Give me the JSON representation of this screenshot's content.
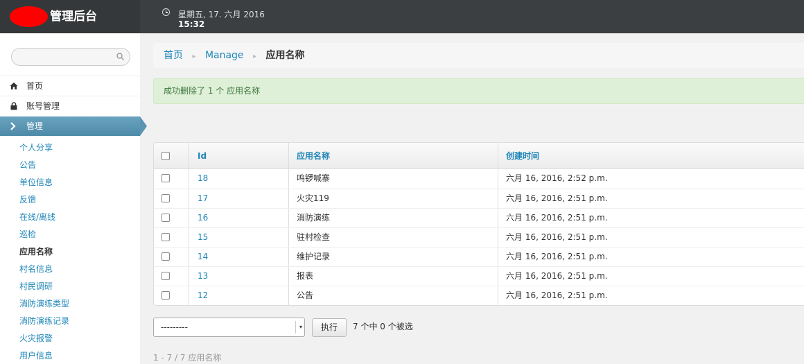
{
  "header": {
    "brand_title": "管理后台",
    "date": "星期五, 17. 六月 2016",
    "time": "15:32"
  },
  "sidebar": {
    "search_placeholder": "",
    "items": [
      {
        "label": "首页",
        "icon": "home-icon"
      },
      {
        "label": "账号管理",
        "icon": "lock-icon"
      }
    ],
    "active_item": {
      "label": "管理",
      "icon": "chevron-right-icon"
    },
    "subitems": [
      {
        "label": "个人分享"
      },
      {
        "label": "公告"
      },
      {
        "label": "单位信息"
      },
      {
        "label": "反馈"
      },
      {
        "label": "在线/离线"
      },
      {
        "label": "巡检"
      },
      {
        "label": "应用名称",
        "current": true
      },
      {
        "label": "村名信息"
      },
      {
        "label": "村民调研"
      },
      {
        "label": "消防演练类型"
      },
      {
        "label": "消防演练记录"
      },
      {
        "label": "火灾报警"
      },
      {
        "label": "用户信息"
      }
    ]
  },
  "breadcrumb": {
    "home": "首页",
    "section": "Manage",
    "current": "应用名称",
    "separator": "▸"
  },
  "alert": {
    "message": "成功删除了 1 个 应用名称"
  },
  "table": {
    "columns": [
      "Id",
      "应用名称",
      "创建时间"
    ],
    "rows": [
      {
        "id": "18",
        "name": "鸣锣喊寨",
        "created": "六月 16, 2016, 2:52 p.m."
      },
      {
        "id": "17",
        "name": "火灾119",
        "created": "六月 16, 2016, 2:51 p.m."
      },
      {
        "id": "16",
        "name": "消防演练",
        "created": "六月 16, 2016, 2:51 p.m."
      },
      {
        "id": "15",
        "name": "驻村检查",
        "created": "六月 16, 2016, 2:51 p.m."
      },
      {
        "id": "14",
        "name": "维护记录",
        "created": "六月 16, 2016, 2:51 p.m."
      },
      {
        "id": "13",
        "name": "报表",
        "created": "六月 16, 2016, 2:51 p.m."
      },
      {
        "id": "12",
        "name": "公告",
        "created": "六月 16, 2016, 2:51 p.m."
      }
    ]
  },
  "actions": {
    "select_value": "---------",
    "run_label": "执行",
    "selected_text": "7 个中 0 个被选"
  },
  "pagination": {
    "text": "1 - 7  /  7 应用名称"
  },
  "colors": {
    "link": "#1e86b8",
    "active_nav": "#5a94b1",
    "alert_bg": "#dff0d8",
    "header_bg": "#3c3f41"
  }
}
